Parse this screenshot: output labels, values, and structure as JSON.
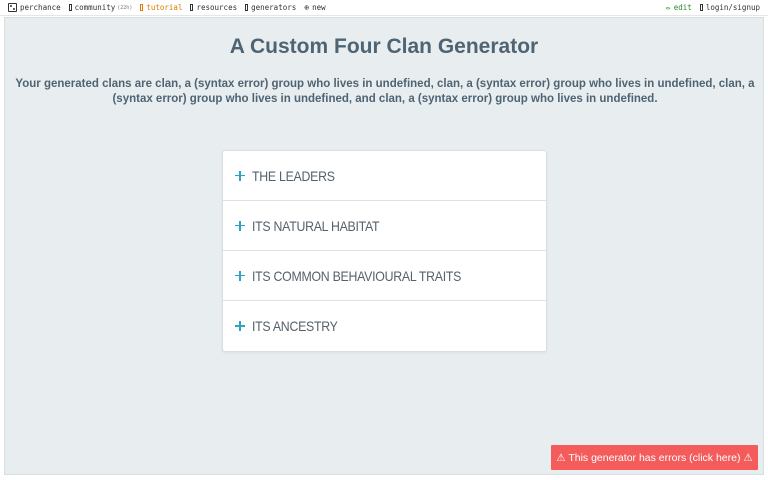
{
  "nav": {
    "brand": "perchance",
    "community": "community",
    "community_count": "(22h)",
    "tutorial": "tutorial",
    "resources": "resources",
    "generators": "generators",
    "new": "new",
    "edit": "edit",
    "login": "login/signup"
  },
  "page": {
    "title": "A Custom Four Clan Generator",
    "description": "Your generated clans are clan, a (syntax error) group who lives in undefined, clan, a (syntax error) group who lives in undefined, clan, a (syntax error) group who lives in undefined, and clan, a (syntax error) group who lives in undefined."
  },
  "accordion": {
    "items": [
      {
        "label": "THE LEADERS"
      },
      {
        "label": "ITS NATURAL HABITAT"
      },
      {
        "label": "ITS COMMON BEHAVIOURAL TRAITS"
      },
      {
        "label": "ITS ANCESTRY"
      }
    ]
  },
  "error": {
    "message": "⚠ This generator has errors (click here) ⚠"
  },
  "colors": {
    "panel_bg": "#e8edf0",
    "title": "#4f6472",
    "accent_plus": "#2aa3c7",
    "error_bg": "#f45b5b",
    "tutorial": "#e07b00",
    "edit": "#2a8a2a"
  }
}
